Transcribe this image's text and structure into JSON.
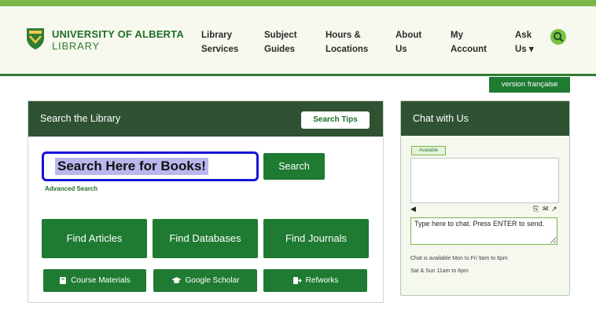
{
  "brand": {
    "line1": "UNIVERSITY OF ALBERTA",
    "line2": "LIBRARY"
  },
  "nav": [
    {
      "line1": "Library",
      "line2": "Services"
    },
    {
      "line1": "Subject",
      "line2": "Guides"
    },
    {
      "line1": "Hours &",
      "line2": "Locations"
    },
    {
      "line1": "About",
      "line2": "Us"
    },
    {
      "line1": "My",
      "line2": "Account"
    },
    {
      "line1": "Ask",
      "line2": "Us ▾"
    }
  ],
  "version_label": "version française",
  "search_panel": {
    "title": "Search the Library",
    "tips_label": "Search Tips",
    "input_text": "Search Here for Books!",
    "search_label": "Search",
    "advanced_label": "Advanced Search",
    "big_buttons": [
      "Find Articles",
      "Find Databases",
      "Find Journals"
    ],
    "small_buttons": [
      "Course Materials",
      "Google Scholar",
      "Refworks"
    ]
  },
  "chat": {
    "title": "Chat with Us",
    "status": "Available",
    "input_placeholder": "Type here to chat. Press ENTER to send.",
    "hours_line1": "Chat is available Mon to Fri 9am to 6pm",
    "hours_line2": "Sat & Sun 11am to 6pm"
  },
  "colors": {
    "brand_green": "#1f7a32",
    "header_dark": "#2f5233",
    "accent_lime": "#7ab648",
    "search_outline": "#1515d9"
  }
}
